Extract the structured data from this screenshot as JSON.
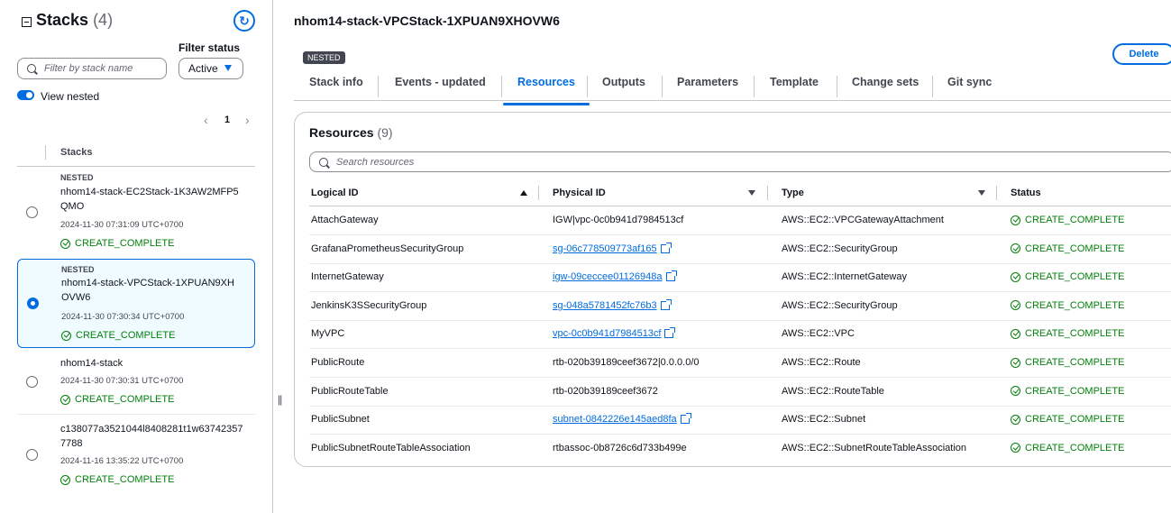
{
  "left_panel": {
    "title": "Stacks",
    "count": "(4)",
    "filter_label": "Filter status",
    "search_placeholder": "Filter by stack name",
    "status_filter": "Active",
    "toggle_label": "View nested",
    "page": "1",
    "list_header": "Stacks",
    "stacks": [
      {
        "tag": "NESTED",
        "name": "nhom14-stack-EC2Stack-1K3AW2MFP5QMO",
        "date": "2024-11-30 07:31:09 UTC+0700",
        "status": "CREATE_COMPLETE",
        "selected": false
      },
      {
        "tag": "NESTED",
        "name": "nhom14-stack-VPCStack-1XPUAN9XHOVW6",
        "date": "2024-11-30 07:30:34 UTC+0700",
        "status": "CREATE_COMPLETE",
        "selected": true
      },
      {
        "tag": "",
        "name": "nhom14-stack",
        "date": "2024-11-30 07:30:31 UTC+0700",
        "status": "CREATE_COMPLETE",
        "selected": false
      },
      {
        "tag": "",
        "name": "c138077a3521044l8408281t1w637423577788",
        "date": "2024-11-16 13:35:22 UTC+0700",
        "status": "CREATE_COMPLETE",
        "selected": false
      }
    ]
  },
  "main": {
    "stack_title": "nhom14-stack-VPCStack-1XPUAN9XHOVW6",
    "badge": "NESTED",
    "delete_label": "Delete",
    "tabs": [
      "Stack info",
      "Events - updated",
      "Resources",
      "Outputs",
      "Parameters",
      "Template",
      "Change sets",
      "Git sync"
    ],
    "active_tab": "Resources",
    "resources": {
      "title": "Resources",
      "count": "(9)",
      "search_placeholder": "Search resources",
      "columns": [
        "Logical ID",
        "Physical ID",
        "Type",
        "Status"
      ],
      "rows": [
        {
          "logical_id": "AttachGateway",
          "physical_id": "IGW|vpc-0c0b941d7984513cf",
          "link": false,
          "type": "AWS::EC2::VPCGatewayAttachment",
          "status": "CREATE_COMPLETE"
        },
        {
          "logical_id": "GrafanaPrometheusSecurityGroup",
          "physical_id": "sg-06c778509773af165",
          "link": true,
          "type": "AWS::EC2::SecurityGroup",
          "status": "CREATE_COMPLETE"
        },
        {
          "logical_id": "InternetGateway",
          "physical_id": "igw-09ceccee01126948a",
          "link": true,
          "type": "AWS::EC2::InternetGateway",
          "status": "CREATE_COMPLETE"
        },
        {
          "logical_id": "JenkinsK3SSecurityGroup",
          "physical_id": "sg-048a5781452fc76b3",
          "link": true,
          "type": "AWS::EC2::SecurityGroup",
          "status": "CREATE_COMPLETE"
        },
        {
          "logical_id": "MyVPC",
          "physical_id": "vpc-0c0b941d7984513cf",
          "link": true,
          "type": "AWS::EC2::VPC",
          "status": "CREATE_COMPLETE"
        },
        {
          "logical_id": "PublicRoute",
          "physical_id": "rtb-020b39189ceef3672|0.0.0.0/0",
          "link": false,
          "type": "AWS::EC2::Route",
          "status": "CREATE_COMPLETE"
        },
        {
          "logical_id": "PublicRouteTable",
          "physical_id": "rtb-020b39189ceef3672",
          "link": false,
          "type": "AWS::EC2::RouteTable",
          "status": "CREATE_COMPLETE"
        },
        {
          "logical_id": "PublicSubnet",
          "physical_id": "subnet-0842226e145aed8fa",
          "link": true,
          "type": "AWS::EC2::Subnet",
          "status": "CREATE_COMPLETE"
        },
        {
          "logical_id": "PublicSubnetRouteTableAssociation",
          "physical_id": "rtbassoc-0b8726c6d733b499e",
          "link": false,
          "type": "AWS::EC2::SubnetRouteTableAssociation",
          "status": "CREATE_COMPLETE"
        }
      ]
    }
  },
  "colors": {
    "accent": "#006ce0",
    "success": "#037f0c",
    "border": "#c6c6cd"
  }
}
